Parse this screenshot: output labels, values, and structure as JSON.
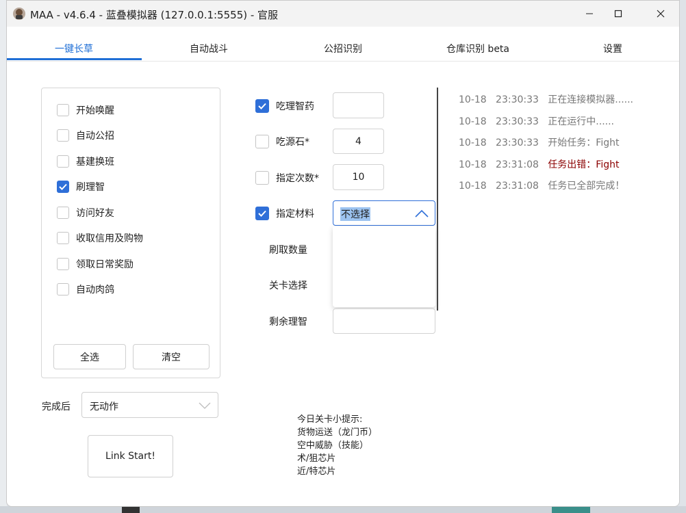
{
  "window": {
    "title": "MAA - v4.6.4 - 蓝叠模拟器 (127.0.0.1:5555) - 官服"
  },
  "tabs": [
    {
      "label": "一键长草",
      "active": true
    },
    {
      "label": "自动战斗"
    },
    {
      "label": "公招识别"
    },
    {
      "label": "仓库识别 beta"
    },
    {
      "label": "设置"
    }
  ],
  "tasks": [
    {
      "label": "开始唤醒",
      "checked": false
    },
    {
      "label": "自动公招",
      "checked": false
    },
    {
      "label": "基建换班",
      "checked": false
    },
    {
      "label": "刷理智",
      "checked": true
    },
    {
      "label": "访问好友",
      "checked": false
    },
    {
      "label": "收取信用及购物",
      "checked": false
    },
    {
      "label": "领取日常奖励",
      "checked": false
    },
    {
      "label": "自动肉鸽",
      "checked": false
    }
  ],
  "buttons": {
    "select_all": "全选",
    "clear": "清空",
    "link_start": "Link Start!"
  },
  "after_finish": {
    "label": "完成后",
    "value": "无动作"
  },
  "fight": {
    "use_medicine": {
      "label": "吃理智药",
      "checked": true,
      "value": ""
    },
    "use_stone": {
      "label": "吃源石*",
      "checked": false,
      "value": "4"
    },
    "times": {
      "label": "指定次数*",
      "checked": false,
      "value": "10"
    },
    "material": {
      "label": "指定材料",
      "checked": true,
      "value": "不选择"
    },
    "drop_count_label": "刷取数量",
    "stage_label": "关卡选择",
    "remaining_label": "剩余理智",
    "remaining_value": ""
  },
  "tips": {
    "title": "今日关卡小提示:",
    "lines": [
      "货物运送（龙门币）",
      "空中威胁（技能）",
      "术/狙芯片",
      "近/特芯片"
    ]
  },
  "log": [
    {
      "date": "10-18",
      "time": "23:30:33",
      "text": "正在连接模拟器......",
      "error": false
    },
    {
      "date": "10-18",
      "time": "23:30:33",
      "text": "正在运行中......",
      "error": false
    },
    {
      "date": "10-18",
      "time": "23:30:33",
      "text": "开始任务：Fight",
      "error": false
    },
    {
      "date": "10-18",
      "time": "23:31:08",
      "text": "任务出错：Fight",
      "error": true
    },
    {
      "date": "10-18",
      "time": "23:31:08",
      "text": "任务已全部完成！",
      "error": false
    }
  ],
  "colors": {
    "accent": "#2f6fd8",
    "error": "#8b0000",
    "log_text": "#777777"
  }
}
